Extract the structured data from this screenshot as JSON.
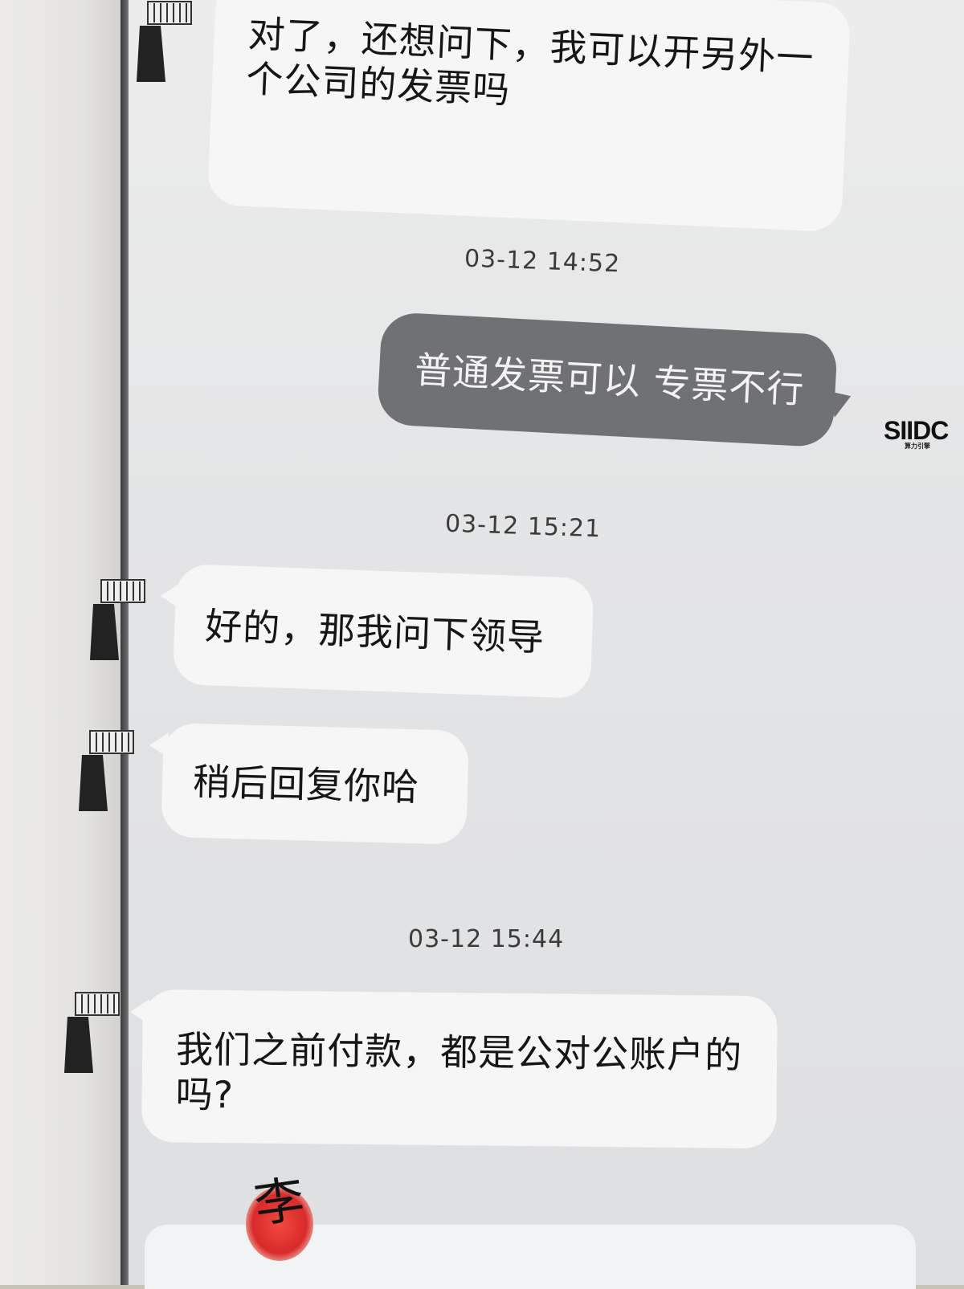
{
  "messages": [
    {
      "direction": "incoming",
      "text": "对了，还想问下，我可以开另外一个公司的发票吗"
    },
    {
      "timestamp": "03-12 14:52"
    },
    {
      "direction": "outgoing",
      "text": "普通发票可以 专票不行"
    },
    {
      "timestamp": "03-12 15:21"
    },
    {
      "direction": "incoming",
      "text": "好的，那我问下领导"
    },
    {
      "direction": "incoming",
      "text": "稍后回复你哈"
    },
    {
      "timestamp": "03-12 15:44"
    },
    {
      "direction": "incoming",
      "text": "我们之前付款，都是公对公账户的吗?"
    }
  ],
  "sender_avatar": {
    "name": "sender-avatar-icon"
  },
  "agent_logo": {
    "text": "SIIDC",
    "sub": "算力引擎"
  },
  "seal": {
    "text": "李",
    "color": "#d92a2a"
  },
  "colors": {
    "incoming_bubble": "#f6f6f7",
    "outgoing_bubble": "#6f7174",
    "chat_bg": "#e4e5e6"
  }
}
